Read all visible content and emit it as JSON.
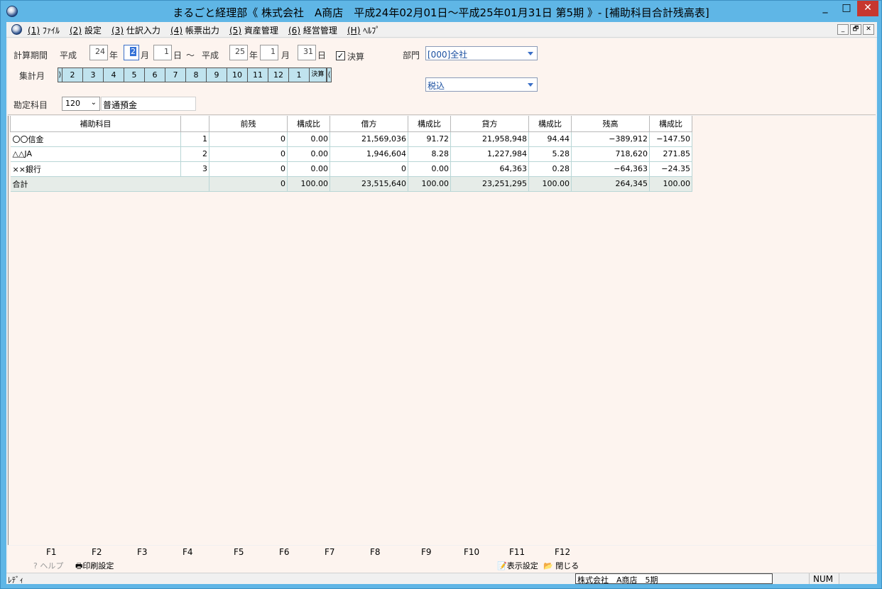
{
  "window": {
    "title": "まるごと経理部《 株式会社　A商店　平成24年02月01日～平成25年01月31日 第5期 》- [補助科目合計残高表]",
    "min_glyph": "_",
    "max_glyph": "□",
    "close_glyph": "✕"
  },
  "menu": {
    "items": [
      {
        "key": "(1)",
        "label": "ﾌｧｲﾙ"
      },
      {
        "key": "(2)",
        "label": "設定"
      },
      {
        "key": "(3)",
        "label": "仕訳入力"
      },
      {
        "key": "(4)",
        "label": "帳票出力"
      },
      {
        "key": "(5)",
        "label": "資産管理"
      },
      {
        "key": "(6)",
        "label": "経営管理"
      },
      {
        "key": "(H)",
        "label": "ﾍﾙﾌﾟ"
      }
    ],
    "mdi": {
      "min": "_",
      "restore": "🗗",
      "close": "✕"
    }
  },
  "form": {
    "period_label": "計算期間",
    "era_label": "平成",
    "start": {
      "year": "24",
      "month": "2",
      "day": "1"
    },
    "end": {
      "year": "25",
      "month": "1",
      "day": "31"
    },
    "year_unit": "年",
    "month_unit": "月",
    "day_unit": "日",
    "tilde": "～",
    "settlement_label": "決算",
    "settlement_checked": "✓",
    "department_label": "部門",
    "department_value": "[000]全社",
    "tax_value": "税込",
    "month_label": "集計月",
    "months": [
      "2",
      "3",
      "4",
      "5",
      "6",
      "7",
      "8",
      "9",
      "10",
      "11",
      "12",
      "1",
      "決算"
    ],
    "account_label": "勘定科目",
    "account_code": "120",
    "account_name": "普通預金"
  },
  "grid": {
    "headers": [
      "補助科目",
      "",
      "前残",
      "構成比",
      "借方",
      "構成比",
      "貸方",
      "構成比",
      "残高",
      "構成比"
    ],
    "rows": [
      {
        "name": "〇〇信金",
        "no": "1",
        "prev": "0",
        "prev_ratio": "0.00",
        "debit": "21,569,036",
        "debit_ratio": "91.72",
        "credit": "21,958,948",
        "credit_ratio": "94.44",
        "balance": "−389,912",
        "balance_ratio": "−147.50"
      },
      {
        "name": "△△JA",
        "no": "2",
        "prev": "0",
        "prev_ratio": "0.00",
        "debit": "1,946,604",
        "debit_ratio": "8.28",
        "credit": "1,227,984",
        "credit_ratio": "5.28",
        "balance": "718,620",
        "balance_ratio": "271.85"
      },
      {
        "name": "××銀行",
        "no": "3",
        "prev": "0",
        "prev_ratio": "0.00",
        "debit": "0",
        "debit_ratio": "0.00",
        "credit": "64,363",
        "credit_ratio": "0.28",
        "balance": "−64,363",
        "balance_ratio": "−24.35"
      }
    ],
    "total": {
      "name": "合計",
      "prev": "0",
      "prev_ratio": "100.00",
      "debit": "23,515,640",
      "debit_ratio": "100.00",
      "credit": "23,251,295",
      "credit_ratio": "100.00",
      "balance": "264,345",
      "balance_ratio": "100.00"
    }
  },
  "fkeys": {
    "keys": [
      "F1",
      "F2",
      "F3",
      "F4",
      "F5",
      "F6",
      "F7",
      "F8",
      "F9",
      "F10",
      "F11",
      "F12"
    ],
    "f1_label": "ヘルプ",
    "f2_label": "印刷設定",
    "f11_label": "表示設定",
    "f12_label": "閉じる"
  },
  "status": {
    "left": "ﾚﾃﾞｨ",
    "company": "株式会社　A商店　5期",
    "num": "NUM"
  }
}
